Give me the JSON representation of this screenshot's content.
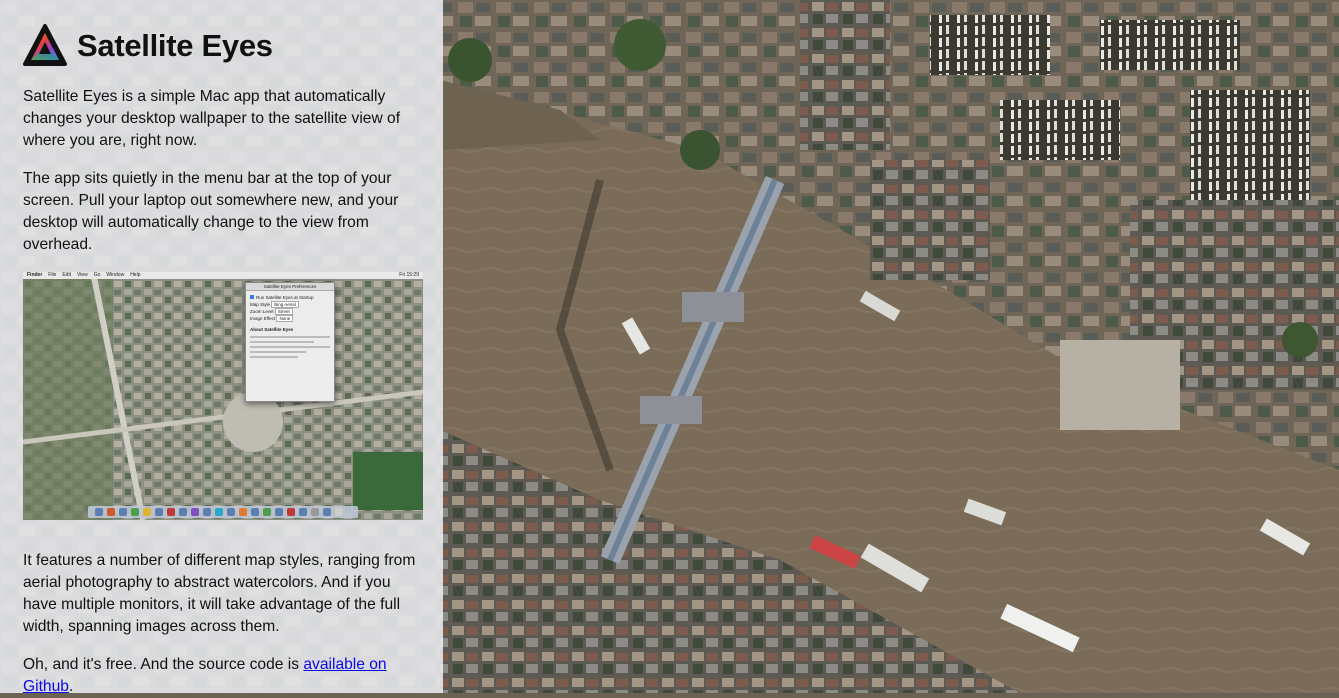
{
  "page": {
    "title": "Satellite Eyes",
    "paragraphs": [
      "Satellite Eyes is a simple Mac app that automatically changes your desktop wallpaper to the satellite view of where you are, right now.",
      "The app sits quietly in the menu bar at the top of your screen. Pull your laptop out somewhere new, and your desktop will automatically change to the view from overhead.",
      "It features a number of different map styles, ranging from aerial photography to abstract watercolors. And if you have multiple monitors, it will take advantage of the full width, spanning images across them."
    ],
    "free_text_before": "Oh, and it's free. And the source code is ",
    "github_link_text": "available on Github",
    "free_text_after": "."
  },
  "screenshot": {
    "menubar_items": [
      "Finder",
      "File",
      "Edit",
      "View",
      "Go",
      "Window",
      "Help"
    ],
    "menubar_clock": "Fri 15:29",
    "prefs_window_title": "Satellite Eyes Preferences",
    "checkbox_label": "Run Satellite Eyes at Startup",
    "map_style_label": "Map Style",
    "map_style_value": "Bing Aerial",
    "zoom_label": "Zoom Level",
    "zoom_value": "Street",
    "effect_label": "Image Effect",
    "effect_value": "None",
    "about_heading": "About Satellite Eyes"
  },
  "colors": {
    "panel_bg": "#eceef2",
    "link": "#0a0ae6",
    "river": "#7a6c58"
  },
  "icons": {
    "logo": "triangle-rainbow-logo-icon"
  }
}
